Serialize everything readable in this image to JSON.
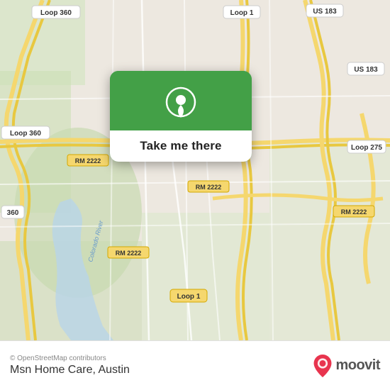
{
  "map": {
    "attribution": "© OpenStreetMap contributors",
    "location_name": "Msn Home Care, Austin",
    "tooltip_label": "Take me there",
    "background_color": "#e8e0d8"
  },
  "roads": {
    "color_yellow": "#f5d76e",
    "color_light": "#ffffff",
    "color_water": "#b0d4e8",
    "color_green": "#c8ddb0"
  },
  "labels": {
    "loop_360_top": "Loop 360",
    "loop_1_top": "Loop 1",
    "us_183_top": "US 183",
    "us_183_right": "US 183",
    "loop_360_left": "Loop 360",
    "rm_2222_left": "RM 2222",
    "rm_2222_center": "RM 2222",
    "rm_2222_right": "RM 2222",
    "rm_2222_bottom": "RM 2222",
    "loop_275": "Loop 275",
    "loop_1_bottom": "Loop 1",
    "colorado_river": "Colorado River",
    "route_360": "360"
  },
  "moovit": {
    "text": "moovit"
  },
  "icons": {
    "pin": "location-pin-icon",
    "moovit_pin": "moovit-pin-icon"
  }
}
